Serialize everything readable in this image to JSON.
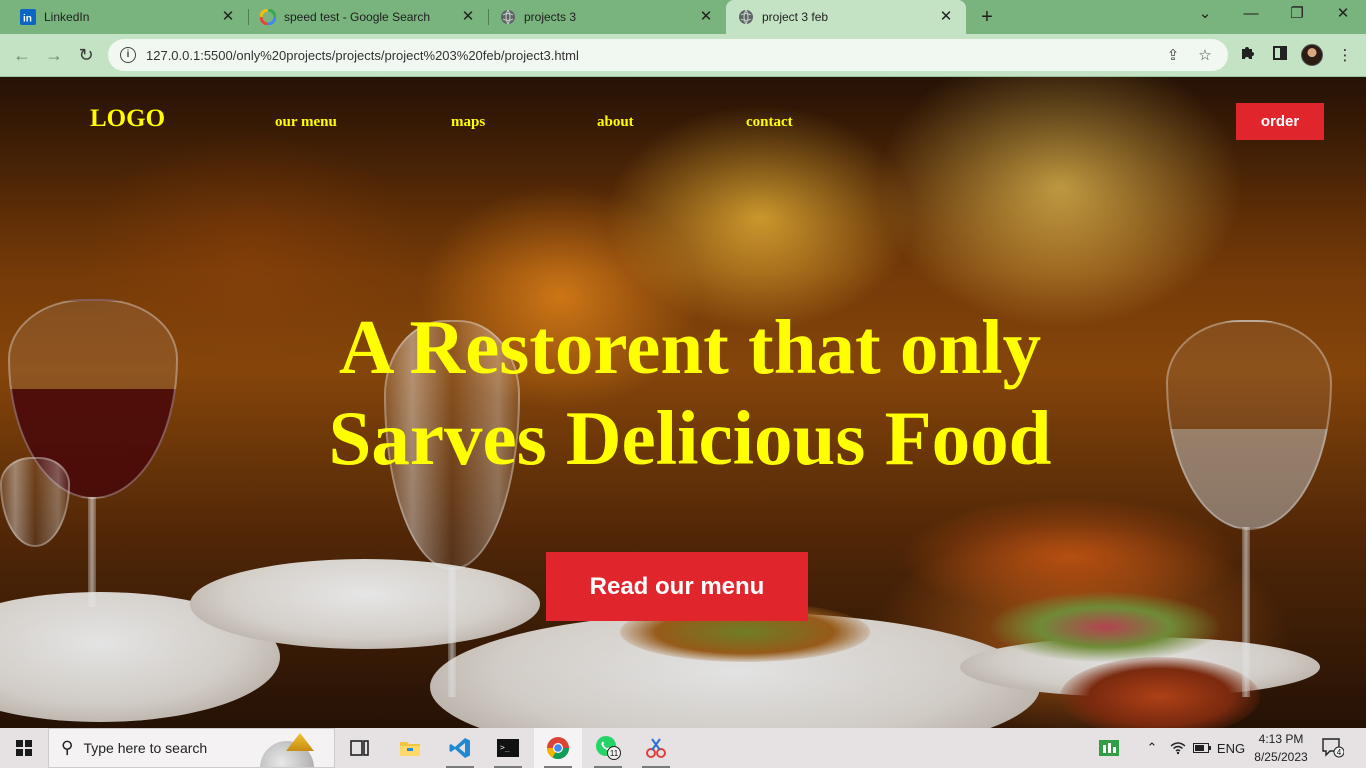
{
  "browser": {
    "tabs": [
      {
        "title": "LinkedIn",
        "icon": "linkedin-icon",
        "active": false
      },
      {
        "title": "speed test - Google Search",
        "icon": "google-icon",
        "active": false
      },
      {
        "title": "projects 3",
        "icon": "globe-icon",
        "active": false
      },
      {
        "title": "project 3 feb",
        "icon": "globe-icon",
        "active": true
      }
    ],
    "new_tab_glyph": "+",
    "url": "127.0.0.1:5500/only%20projects/projects/project%203%20feb/project3.html",
    "colors": {
      "tab_strip": "#79b37d",
      "toolbar": "#c4e3c4"
    }
  },
  "site": {
    "logo": "LOGO",
    "nav": [
      "our menu",
      "maps",
      "about",
      "contact"
    ],
    "order_button": "order",
    "hero_line1": "A Restorent that only",
    "hero_line2": "Sarves Delicious Food",
    "hero_button": "Read our menu",
    "colors": {
      "accent_text": "#ffff00",
      "button": "#e0262c"
    }
  },
  "taskbar": {
    "search_placeholder": "Type here to search",
    "apps": [
      "task-view-icon",
      "file-explorer-icon",
      "vscode-icon",
      "terminal-icon",
      "chrome-icon",
      "whatsapp-icon",
      "snipping-tool-icon"
    ],
    "whatsapp_badge": "11",
    "language": "ENG",
    "time": "4:13 PM",
    "date": "8/25/2023",
    "notification_count": "4"
  }
}
